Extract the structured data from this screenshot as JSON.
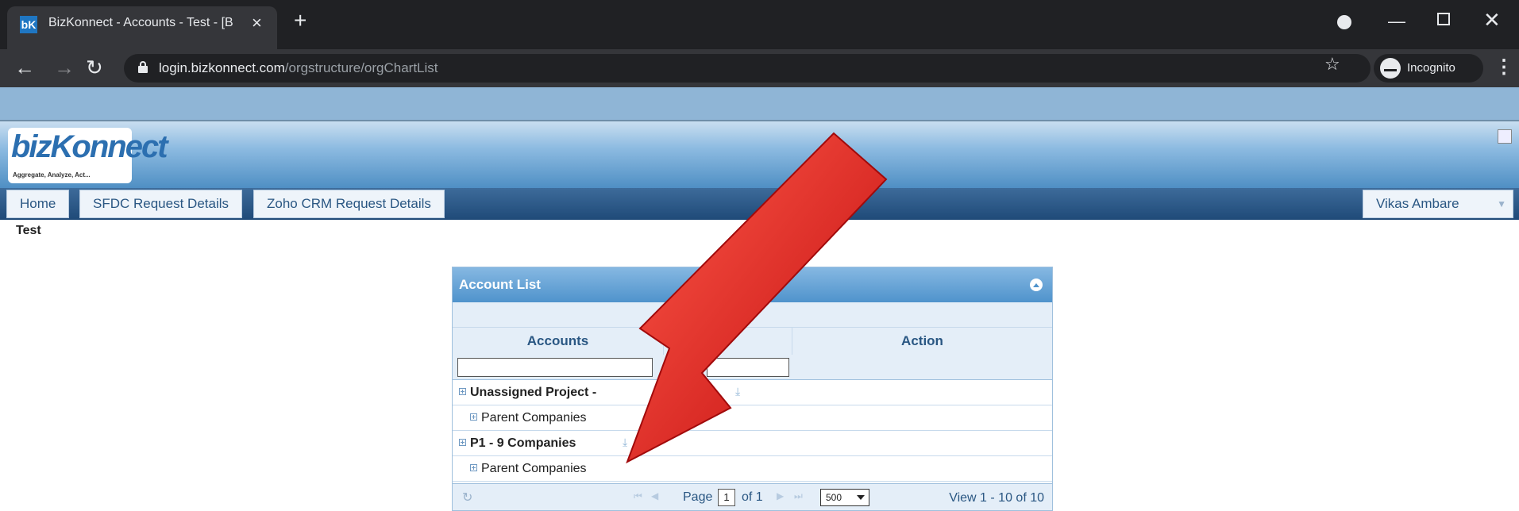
{
  "browser": {
    "tab_title": "BizKonnect - Accounts - Test - [B",
    "favicon_text": "bK",
    "url_host": "login.bizkonnect.com",
    "url_path": "/orgstructure/orgChartList",
    "incognito_label": "Incognito"
  },
  "app": {
    "logo_text": "bizKonnect",
    "logo_tagline": "Aggregate, Analyze, Act...",
    "nav": [
      "Home",
      "SFDC Request Details",
      "Zoho CRM Request Details"
    ],
    "user": "Vikas Ambare",
    "page_label": "Test"
  },
  "panel": {
    "title": "Account List",
    "columns": [
      "Accounts",
      "Action"
    ],
    "rows": [
      {
        "label": "Unassigned Project -",
        "bold": true
      },
      {
        "label": "Parent Companies",
        "bold": false
      },
      {
        "label": "P1 - 9 Companies",
        "bold": true
      },
      {
        "label": "Parent Companies",
        "bold": false
      }
    ],
    "pager": {
      "page_label": "Page",
      "page_value": "1",
      "of_label": "of 1",
      "rows_per_page": "500",
      "view_text": "View 1 - 10 of 10"
    }
  },
  "colors": {
    "arrow": "#e8181a",
    "header_blue": "#4f93cc"
  }
}
